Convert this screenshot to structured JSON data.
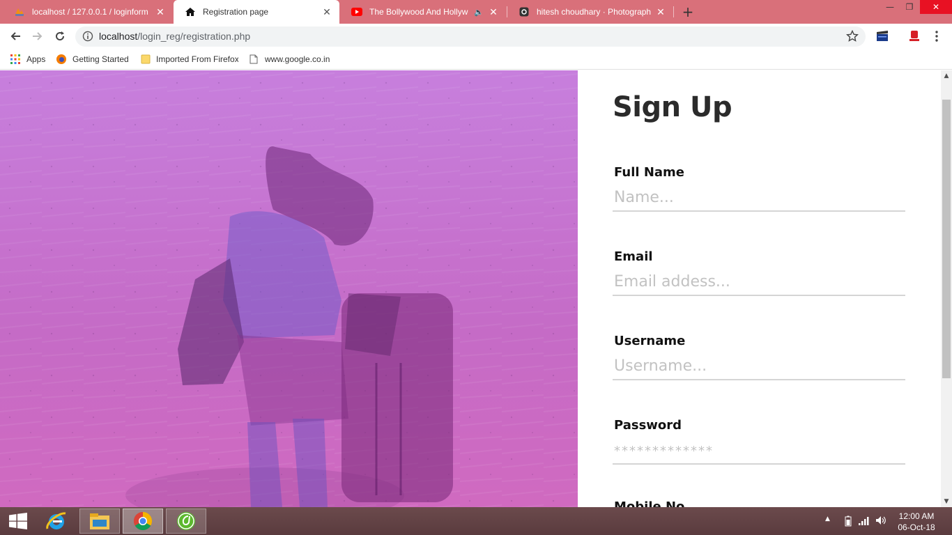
{
  "browser": {
    "tabs": [
      {
        "title": "localhost / 127.0.0.1 / loginform",
        "icon": "phpmyadmin-icon",
        "active": false
      },
      {
        "title": "Registration page",
        "icon": "home-icon",
        "active": true
      },
      {
        "title": "The Bollywood And Hollywood",
        "icon": "youtube-icon",
        "active": false,
        "audio": true
      },
      {
        "title": "hitesh choudhary · Photography",
        "icon": "instagram-icon",
        "active": false
      }
    ],
    "new_tab_label": "+",
    "url_host": "localhost",
    "url_path": "/login_reg/registration.php",
    "bookmarks": [
      {
        "label": "Apps",
        "icon": "apps-grid-icon"
      },
      {
        "label": "Getting Started",
        "icon": "firefox-icon"
      },
      {
        "label": "Imported From Firefox",
        "icon": "folder-icon"
      },
      {
        "label": "www.google.co.in",
        "icon": "page-icon"
      }
    ]
  },
  "page": {
    "title": "Sign Up",
    "fields": [
      {
        "label": "Full Name",
        "placeholder": "Name..."
      },
      {
        "label": "Email",
        "placeholder": "Email addess..."
      },
      {
        "label": "Username",
        "placeholder": "Username..."
      },
      {
        "label": "Password",
        "placeholder": "*************"
      }
    ],
    "next_field_partial": "Mobile No"
  },
  "taskbar": {
    "apps": [
      "internet-explorer-icon",
      "file-explorer-icon",
      "chrome-icon",
      "dreamweaver-icon"
    ],
    "clock_time": "12:00 AM",
    "clock_date": "06-Oct-18"
  },
  "colors": {
    "tabstrip": "#d9707a",
    "hero_top": "#c77fdd",
    "hero_bottom": "#d06ac0",
    "taskbar": "#5a3b3e"
  }
}
